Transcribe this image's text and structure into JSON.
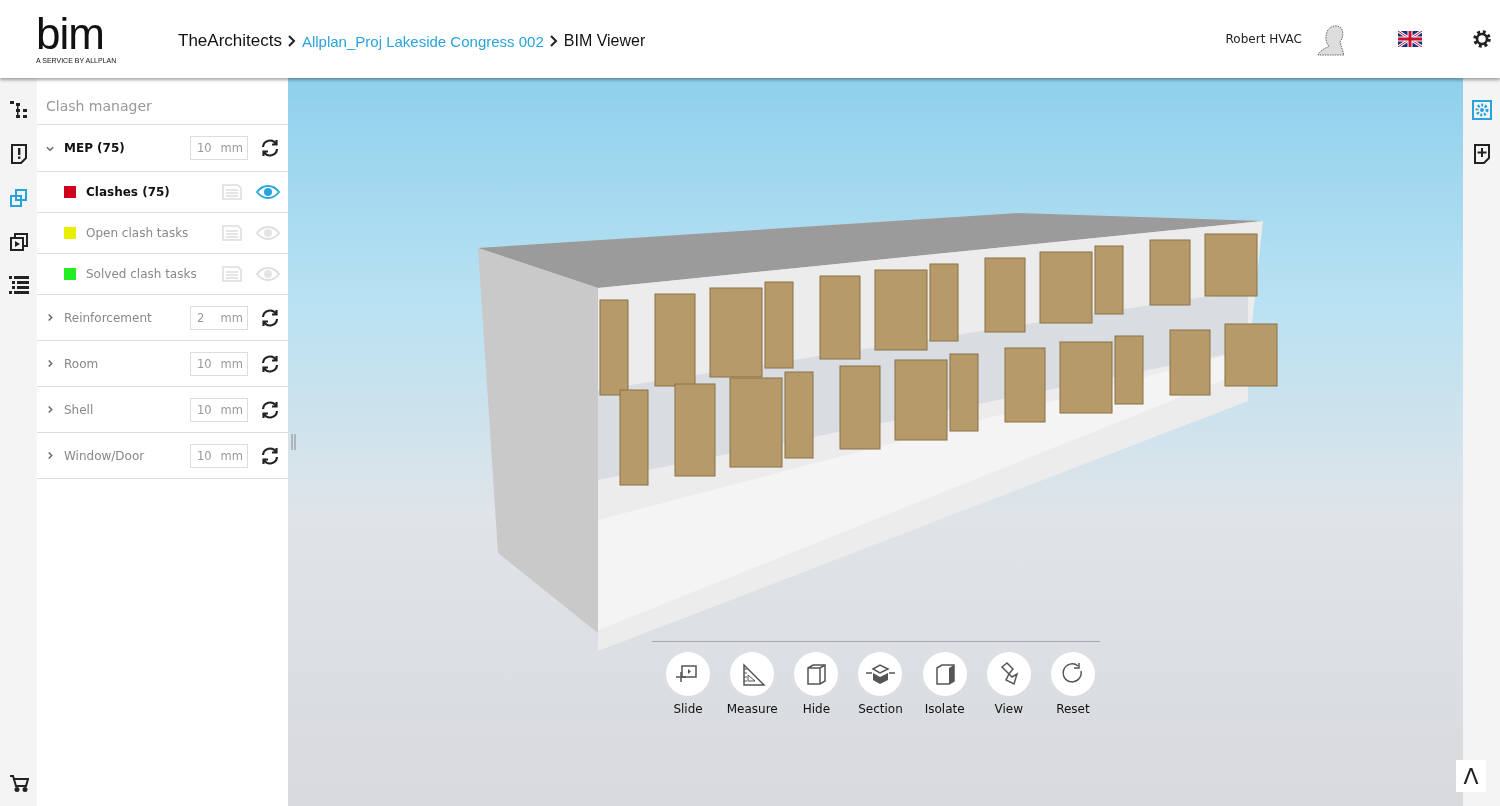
{
  "header": {
    "logo": {
      "word": "bim",
      "tagline": "A SERVICE BY ALLPLAN"
    },
    "breadcrumb": [
      {
        "label": "TheArchitects",
        "kind": "plain"
      },
      {
        "label": "Allplan_Proj Lakeside Congress 002",
        "kind": "link"
      },
      {
        "label": "BIM Viewer",
        "kind": "current"
      }
    ],
    "user_name": "Robert HVAC"
  },
  "left_rail": [
    {
      "kind": "tree",
      "selected": false
    },
    {
      "kind": "issue",
      "selected": false
    },
    {
      "kind": "clash",
      "selected": true
    },
    {
      "kind": "slides",
      "selected": false
    },
    {
      "kind": "list",
      "selected": false
    },
    {
      "kind": "cart",
      "selected": false
    }
  ],
  "clash_panel": {
    "title": "Clash manager",
    "groups": [
      {
        "name": "MEP (75)",
        "expanded": true,
        "tolerance": "10",
        "unit": "mm",
        "children": [
          {
            "label": "Clashes (75)",
            "color": "#d0021b",
            "visible": true
          },
          {
            "label": "Open clash tasks",
            "color": "#e6f000",
            "visible": false
          },
          {
            "label": "Solved clash tasks",
            "color": "#22ee22",
            "visible": false
          }
        ]
      },
      {
        "name": "Reinforcement",
        "expanded": false,
        "tolerance": "2",
        "unit": "mm"
      },
      {
        "name": "Room",
        "expanded": false,
        "tolerance": "10",
        "unit": "mm"
      },
      {
        "name": "Shell",
        "expanded": false,
        "tolerance": "10",
        "unit": "mm"
      },
      {
        "name": "Window/Door",
        "expanded": false,
        "tolerance": "10",
        "unit": "mm"
      }
    ]
  },
  "toolbar": [
    {
      "label": "Slide",
      "kind": "slide"
    },
    {
      "label": "Measure",
      "kind": "measure"
    },
    {
      "label": "Hide",
      "kind": "hide"
    },
    {
      "label": "Section",
      "kind": "section"
    },
    {
      "label": "Isolate",
      "kind": "isolate"
    },
    {
      "label": "View",
      "kind": "view"
    },
    {
      "label": "Reset",
      "kind": "reset"
    }
  ],
  "right_rail": [
    {
      "kind": "settings",
      "selected": true
    },
    {
      "kind": "add",
      "selected": false
    }
  ],
  "collapse_button": "Λ"
}
